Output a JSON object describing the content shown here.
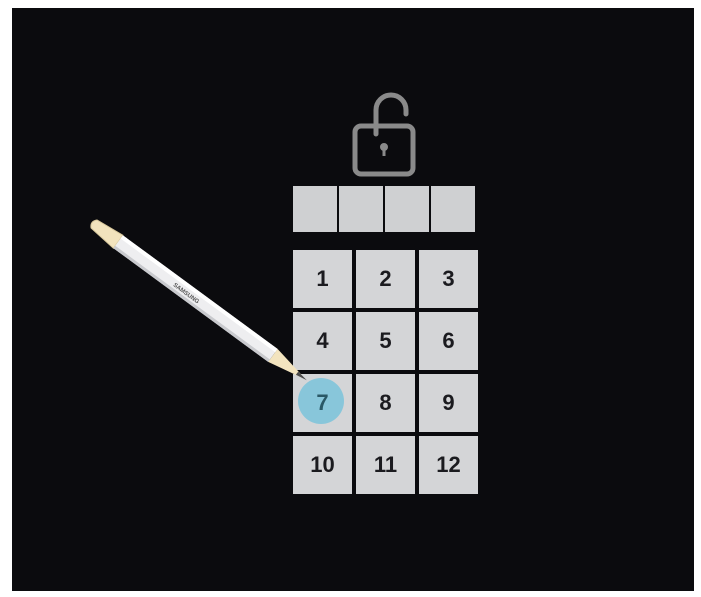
{
  "lock": {
    "icon": "unlocked-padlock-icon",
    "color": "#8a8a8a"
  },
  "pin_display": {
    "slots": [
      "",
      "",
      "",
      ""
    ]
  },
  "keypad": {
    "keys": [
      "1",
      "2",
      "3",
      "4",
      "5",
      "6",
      "7",
      "8",
      "9",
      "10",
      "11",
      "12"
    ],
    "active_key": "7",
    "highlight_color": "#7fc4da"
  },
  "stylus": {
    "brand": "SAMSUNG",
    "icon": "stylus-pen-icon"
  }
}
